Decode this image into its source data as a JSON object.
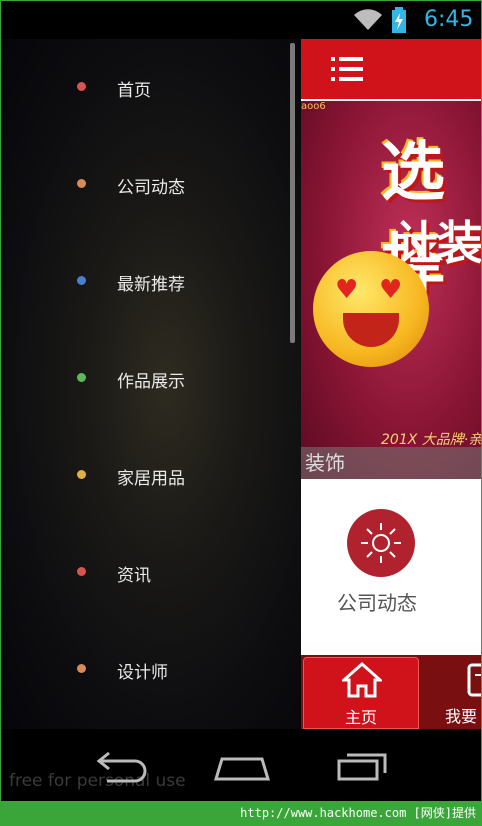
{
  "status_bar": {
    "time": "6:45",
    "icons": [
      "wifi-icon",
      "battery-charging-icon"
    ],
    "clock_color": "#33b5e5"
  },
  "drawer": {
    "items": [
      {
        "label": "首页",
        "dot_color": "#d9534f"
      },
      {
        "label": "公司动态",
        "dot_color": "#d98a5a"
      },
      {
        "label": "最新推荐",
        "dot_color": "#4a7fd0"
      },
      {
        "label": "作品展示",
        "dot_color": "#5cb85c"
      },
      {
        "label": "家居用品",
        "dot_color": "#e0b040"
      },
      {
        "label": "资讯",
        "dot_color": "#d9534f"
      },
      {
        "label": "设计师",
        "dot_color": "#d98a5a"
      }
    ]
  },
  "app": {
    "accent_color": "#d0121b",
    "banner": {
      "headline_line1": "选择",
      "headline_line2": "让装",
      "promo_text": "201X 大品牌·亲",
      "caption": "装饰",
      "top_strip": "aoo6"
    },
    "card": {
      "label": "公司动态"
    },
    "tabs": [
      {
        "label": "主页",
        "icon": "home-icon",
        "active": true
      },
      {
        "label": "我要",
        "icon": "doc-icon",
        "active": false
      }
    ]
  },
  "nav_bar": {
    "watermark": "free for personal use",
    "buttons": [
      "back-icon",
      "home-nav-icon",
      "recents-icon"
    ]
  },
  "credit": "http://www.hackhome.com [网侠]提供"
}
